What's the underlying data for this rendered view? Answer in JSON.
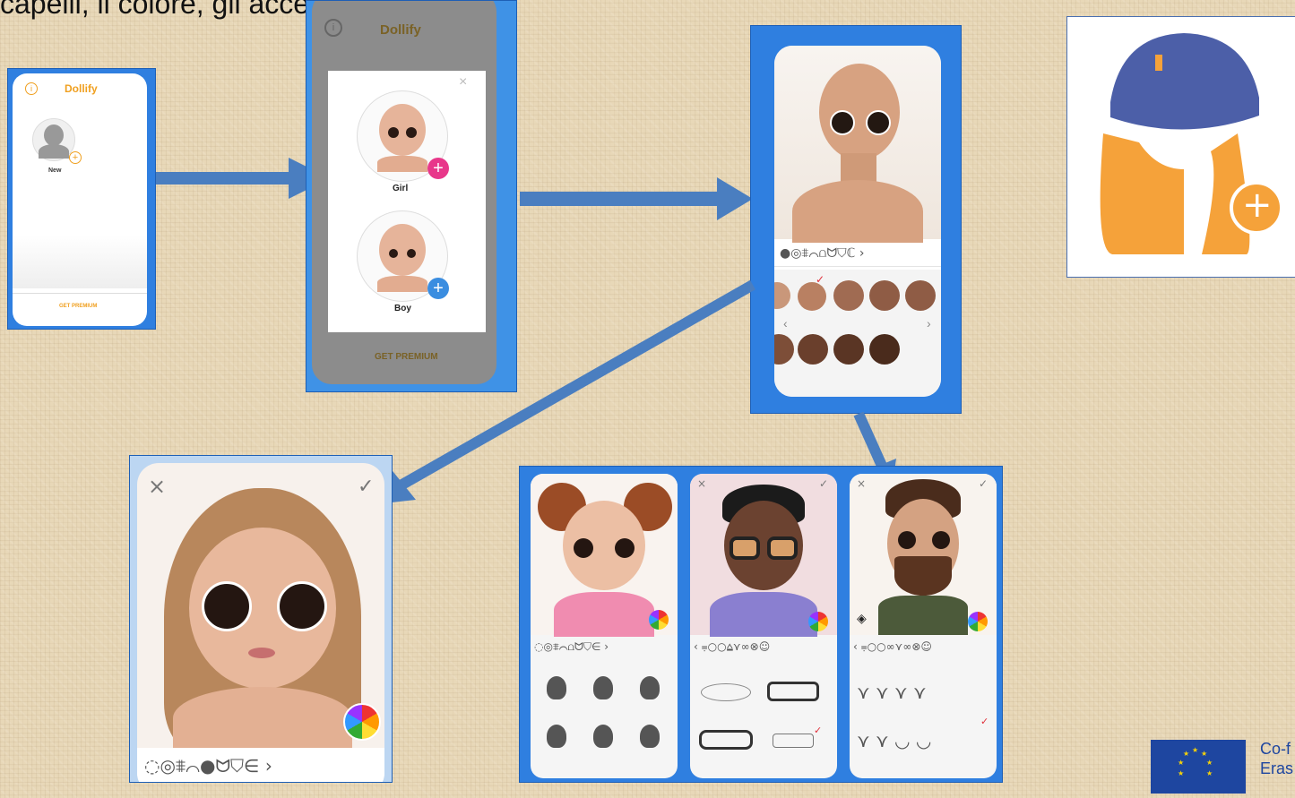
{
  "heading": "capelli, il colore, gli accessori, ecc ...",
  "screen1": {
    "title": "Dollify",
    "info_icon": "info-icon",
    "new_label": "New",
    "premium_label": "GET PREMIUM"
  },
  "screen2": {
    "title": "Dollify",
    "girl_label": "Girl",
    "boy_label": "Boy",
    "premium_label": "GET PREMIUM",
    "girl_plus_color": "#e8378a",
    "boy_plus_color": "#3a8de0"
  },
  "screen3": {
    "close": "×",
    "confirm": "✓",
    "categories": "●◎⩨⌒⩍ᗢ⛉ℂ ›",
    "skin_tones": [
      "#c9977a",
      "#b98062",
      "#a06b52",
      "#8f5c45",
      "#7d4e38",
      "#6a3f2c",
      "#5a3524",
      "#4a2b1c"
    ]
  },
  "screen4": {
    "close": "×",
    "confirm": "✓",
    "categories": "◌◎⩨⌒●ᗢ⛉∈ ›"
  },
  "screen5": {
    "panels": [
      {
        "close": "×",
        "confirm": "✓",
        "categories": "◌◎⩨⌒⩍ᗢ⛉∈ ›"
      },
      {
        "close": "×",
        "confirm": "✓",
        "categories": "‹ ⩦○○⩠⋎∞⊗☺"
      },
      {
        "close": "×",
        "confirm": "✓",
        "categories": "‹ ⩦○○∞⋎∞⊗☺"
      }
    ]
  },
  "hair_icon": {
    "plus": "+",
    "cap_color": "#4c5fa8",
    "hair_color": "#f5a23a"
  },
  "eu_logo": {
    "line1": "Co-f",
    "line2": "Eras"
  },
  "colors": {
    "frame": "#2f7fe0",
    "arrow": "#4a7ec0",
    "accent": "#f0a020"
  }
}
